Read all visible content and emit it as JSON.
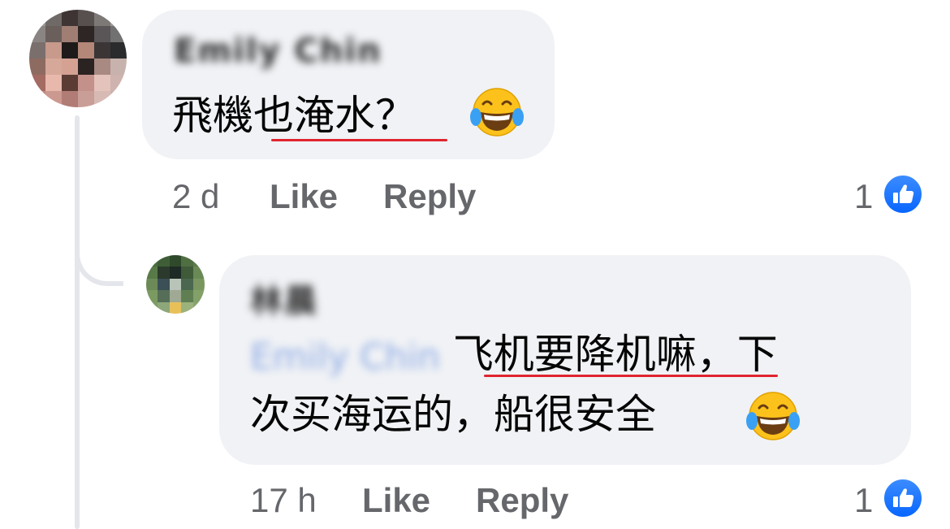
{
  "comments": [
    {
      "author_name": "Emily Chin",
      "text_prefix": "飛機",
      "text_marked": "也淹水",
      "text_suffix": "？",
      "emoji": "tears-of-joy-emoji",
      "time": "2 d",
      "like_label": "Like",
      "reply_label": "Reply",
      "reaction_count": "1",
      "reaction_icon": "thumbs-up-icon"
    },
    {
      "author_name": "林晨",
      "mention": "Emily Chin",
      "line1_marked": "飞机要降机嘛",
      "line1_suffix": "，下",
      "line2": "次买海运的，船很安全",
      "emoji": "tears-of-joy-emoji",
      "time": "17 h",
      "like_label": "Like",
      "reply_label": "Reply",
      "reaction_count": "1",
      "reaction_icon": "thumbs-up-icon"
    }
  ],
  "colors": {
    "bubble": "#f0f2f5",
    "meta_text": "#65676b",
    "like_blue": "#0866ff",
    "underline_red": "#e0242f"
  }
}
